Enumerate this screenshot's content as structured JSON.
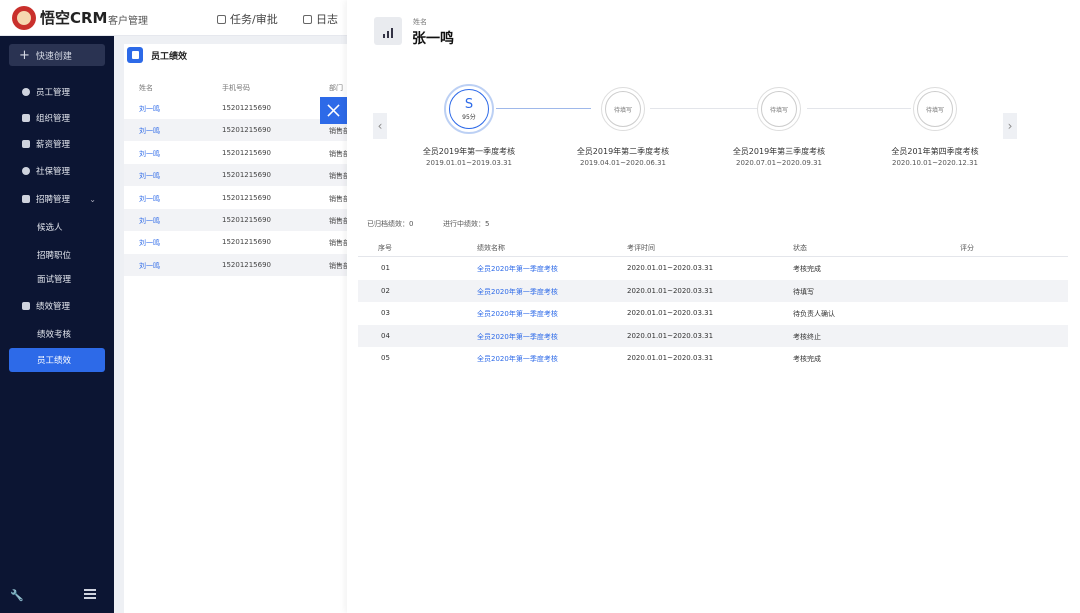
{
  "topbar": {
    "brand": "悟空CRM",
    "subtitle": "客户管理",
    "nav": [
      {
        "label": "任务/审批",
        "icon": "briefcase-icon"
      },
      {
        "label": "日志",
        "icon": "doc-icon"
      }
    ]
  },
  "sidebar": {
    "quick_create": "快速创建",
    "items": [
      {
        "label": "员工管理",
        "icon": "user-icon"
      },
      {
        "label": "组织管理",
        "icon": "org-icon"
      },
      {
        "label": "薪资管理",
        "icon": "wallet-icon"
      },
      {
        "label": "社保管理",
        "icon": "shield-icon"
      },
      {
        "label": "招聘管理",
        "icon": "recruit-icon"
      },
      {
        "label": "候选人"
      },
      {
        "label": "招聘职位"
      },
      {
        "label": "面试管理"
      },
      {
        "label": "绩效管理",
        "icon": "chart-icon"
      },
      {
        "label": "绩效考核"
      },
      {
        "label": "员工绩效"
      }
    ]
  },
  "list": {
    "title": "员工绩效",
    "columns": [
      "姓名",
      "手机号码",
      "部门"
    ],
    "rows": [
      {
        "name": "刘一鸣",
        "phone": "15201215690",
        "dept": ""
      },
      {
        "name": "刘一鸣",
        "phone": "15201215690",
        "dept": "销售部"
      },
      {
        "name": "刘一鸣",
        "phone": "15201215690",
        "dept": "销售部"
      },
      {
        "name": "刘一鸣",
        "phone": "15201215690",
        "dept": "销售部"
      },
      {
        "name": "刘一鸣",
        "phone": "15201215690",
        "dept": "销售部"
      },
      {
        "name": "刘一鸣",
        "phone": "15201215690",
        "dept": "销售部"
      },
      {
        "name": "刘一鸣",
        "phone": "15201215690",
        "dept": "销售部"
      },
      {
        "name": "刘一鸣",
        "phone": "15201215690",
        "dept": "销售部"
      }
    ]
  },
  "drawer": {
    "label": "姓名",
    "name": "张一鸣",
    "stages": [
      {
        "title": "全员2019年第一季度考核",
        "date": "2019.01.01~2019.03.31",
        "grade": "S",
        "score": "95分",
        "status": ""
      },
      {
        "title": "全员2019年第二季度考核",
        "date": "2019.04.01~2020.06.31",
        "grade": "",
        "score": "",
        "status": "待填写"
      },
      {
        "title": "全员2019年第三季度考核",
        "date": "2020.07.01~2020.09.31",
        "grade": "",
        "score": "",
        "status": "待填写"
      },
      {
        "title": "全员201年第四季度考核",
        "date": "2020.10.01~2020.12.31",
        "grade": "",
        "score": "",
        "status": "待填写"
      }
    ],
    "stats": {
      "archived_label": "已归档绩效：",
      "archived_value": "0",
      "inprogress_label": "进行中绩效：",
      "inprogress_value": "5"
    },
    "table": {
      "columns": [
        "序号",
        "绩效名称",
        "考评时间",
        "状态",
        "评分"
      ],
      "rows": [
        {
          "no": "01",
          "name": "全员2020年第一季度考核",
          "period": "2020.01.01~2020.03.31",
          "status": "考核完成",
          "score": ""
        },
        {
          "no": "02",
          "name": "全员2020年第一季度考核",
          "period": "2020.01.01~2020.03.31",
          "status": "待填写",
          "score": ""
        },
        {
          "no": "03",
          "name": "全员2020年第一季度考核",
          "period": "2020.01.01~2020.03.31",
          "status": "待负责人确认",
          "score": ""
        },
        {
          "no": "04",
          "name": "全员2020年第一季度考核",
          "period": "2020.01.01~2020.03.31",
          "status": "考核终止",
          "score": ""
        },
        {
          "no": "05",
          "name": "全员2020年第一季度考核",
          "period": "2020.01.01~2020.03.31",
          "status": "考核完成",
          "score": ""
        }
      ]
    }
  },
  "colors": {
    "accent": "#2d6ae8",
    "sidebar": "#0c1533",
    "active_nav": "#2d6ae8"
  }
}
